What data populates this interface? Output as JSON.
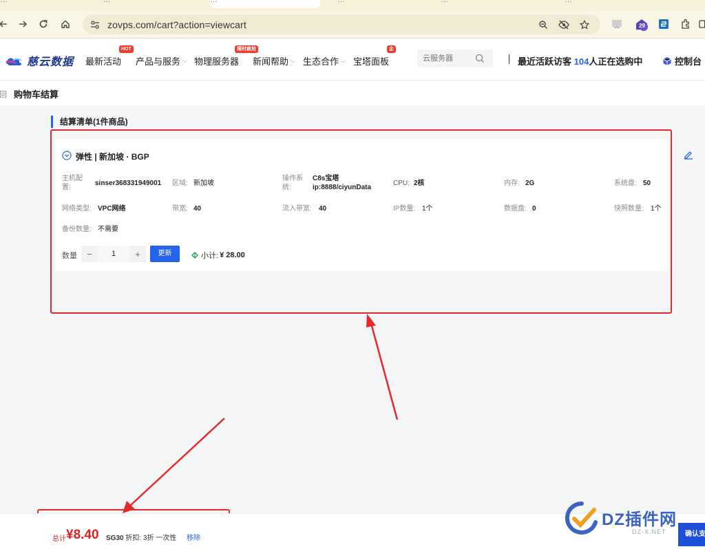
{
  "browser": {
    "tabs": [
      "…",
      "…",
      "…",
      "…",
      "…",
      "…"
    ],
    "url": "zovps.com/cart?action=viewcart",
    "extension_badge": "29"
  },
  "header": {
    "logo_text": "慈云数据",
    "nav": [
      {
        "label": "最新活动",
        "badge": "HOT",
        "has_dropdown": false
      },
      {
        "label": "产品与服务",
        "badge": "",
        "has_dropdown": true
      },
      {
        "label": "物理服务器",
        "badge": "",
        "has_dropdown": false
      },
      {
        "label": "新闻帮助",
        "badge": "限时疯抢",
        "has_dropdown": true
      },
      {
        "label": "生态合作",
        "badge": "",
        "has_dropdown": true
      },
      {
        "label": "宝塔面板",
        "badge": "企",
        "has_dropdown": false
      }
    ],
    "search_placeholder": "云服务器",
    "visitors_prefix": "最近活跃访客",
    "visitors_count": "104",
    "visitors_suffix": "人正在选购中",
    "console_label": "控制台"
  },
  "breadcrumb": {
    "back_label": "返回",
    "title": "购物车结算"
  },
  "cart": {
    "section_title": "结算清单(1件商品)",
    "item": {
      "name": "弹性 | 新加坡 · BGP",
      "config": [
        {
          "key": "主机配置:",
          "value": "sinser368331949001"
        },
        {
          "key": "区域:",
          "value": "新加坡"
        },
        {
          "key": "操作系统:",
          "value": "C8s宝塔 ip:8888/ciyunData"
        },
        {
          "key": "CPU:",
          "value": "2核"
        },
        {
          "key": "内存:",
          "value": "2G"
        },
        {
          "key": "系统盘:",
          "value": "50"
        },
        {
          "key": "网络类型:",
          "value": "VPC网络"
        },
        {
          "key": "带宽:",
          "value": "40"
        },
        {
          "key": "流入带宽:",
          "value": "40"
        },
        {
          "key": "IP数量:",
          "value": "1个"
        },
        {
          "key": "数据盘:",
          "value": "0"
        },
        {
          "key": "快照数量:",
          "value": "1个"
        },
        {
          "key": "备份数量:",
          "value": "不需要"
        }
      ],
      "quantity_label": "数量",
      "quantity": "1",
      "update_label": "更新",
      "subtotal_label": "小计:",
      "subtotal_value": "¥ 28.00"
    }
  },
  "footer_bar": {
    "total_label": "总计",
    "total_value": "¥8.40",
    "promo_code": "SG30",
    "promo_text": "折扣: 3折 一次性",
    "remove_label": "移除",
    "confirm_label": "确认支付"
  },
  "watermark": {
    "text": "DZ插件网",
    "sub": "DZ-X.NET"
  },
  "colors": {
    "accent": "#2563eb",
    "price_red": "#d22222",
    "annotation_red": "#e32a2a"
  }
}
